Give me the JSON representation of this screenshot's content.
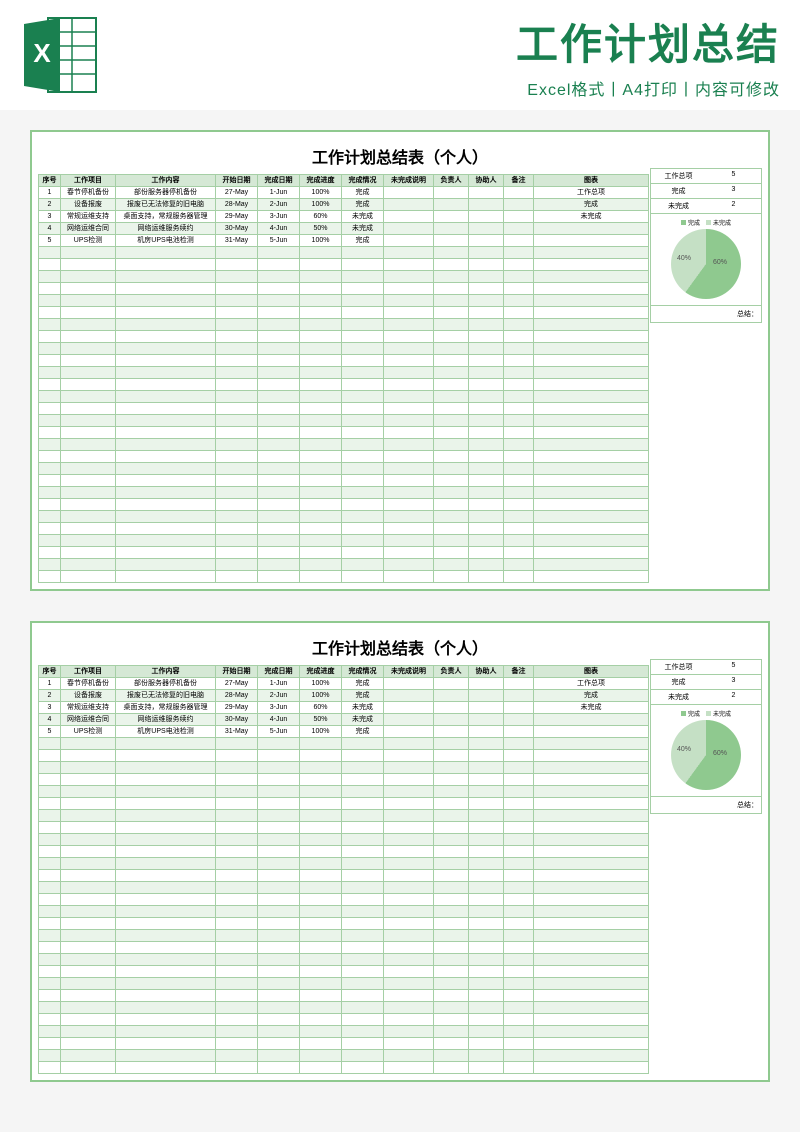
{
  "header": {
    "title": "工作计划总结",
    "subtitle": "Excel格式丨A4打印丨内容可修改"
  },
  "sheet": {
    "title": "工作计划总结表（个人）",
    "columns": [
      "序号",
      "工作项目",
      "工作内容",
      "开始日期",
      "完成日期",
      "完成进度",
      "完成情况",
      "未完成说明",
      "负责人",
      "协助人",
      "备注",
      "图表"
    ],
    "rows": [
      {
        "no": "1",
        "proj": "春节停机备份",
        "content": "部份服务器停机备份",
        "start": "27-May",
        "end": "1-Jun",
        "prog": "100%",
        "status": "完成"
      },
      {
        "no": "2",
        "proj": "设备报废",
        "content": "报废已无法修复的旧电脑",
        "start": "28-May",
        "end": "2-Jun",
        "prog": "100%",
        "status": "完成"
      },
      {
        "no": "3",
        "proj": "常规运维支持",
        "content": "桌面支持，常规服务器管理",
        "start": "29-May",
        "end": "3-Jun",
        "prog": "60%",
        "status": "未完成"
      },
      {
        "no": "4",
        "proj": "网络运维合同",
        "content": "网络运维服务续约",
        "start": "30-May",
        "end": "4-Jun",
        "prog": "50%",
        "status": "未完成"
      },
      {
        "no": "5",
        "proj": "UPS检测",
        "content": "机房UPS电池检测",
        "start": "31-May",
        "end": "5-Jun",
        "prog": "100%",
        "status": "完成"
      }
    ],
    "stats": {
      "total_label": "工作总项",
      "total_value": "5",
      "done_label": "完成",
      "done_value": "3",
      "undone_label": "未完成",
      "undone_value": "2"
    },
    "summary_label": "总结：",
    "legend": {
      "done": "完成",
      "undone": "未完成"
    }
  },
  "chart_data": {
    "type": "pie",
    "title": "",
    "series": [
      {
        "name": "完成",
        "value": 60,
        "color": "#8fc98f",
        "label": "60%"
      },
      {
        "name": "未完成",
        "value": 40,
        "color": "#c5e0c5",
        "label": "40%"
      }
    ]
  }
}
